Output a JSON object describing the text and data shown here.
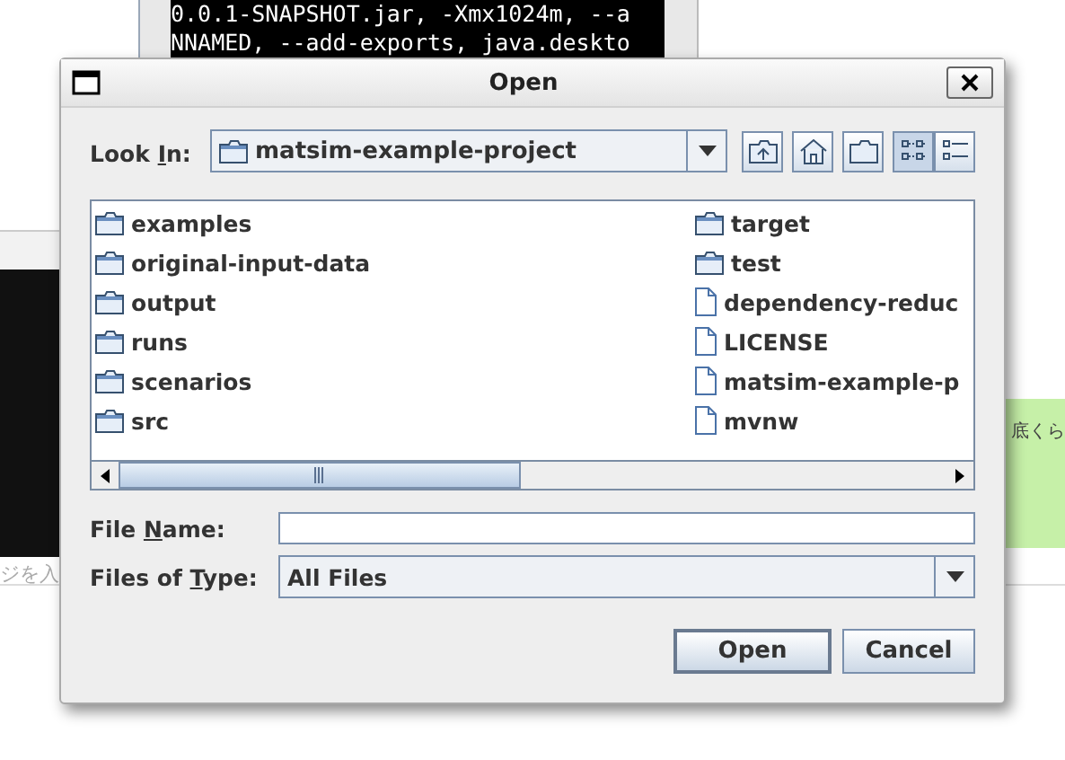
{
  "background": {
    "terminal_lines": [
      "0.0.1-SNAPSHOT.jar, -Xmx1024m, --a",
      "NNAMED, --add-exports, java.deskto"
    ],
    "left_text": "ジを入",
    "right_text": "底くら"
  },
  "window": {
    "title": "Open"
  },
  "look_in": {
    "label_parts": [
      "Look ",
      "I",
      "n:"
    ],
    "value": "matsim-example-project"
  },
  "toolbar": [
    {
      "kind": "up",
      "selected": false
    },
    {
      "kind": "home",
      "selected": false
    },
    {
      "kind": "new-folder",
      "selected": false
    },
    {
      "kind": "list",
      "selected": true
    },
    {
      "kind": "details",
      "selected": false
    }
  ],
  "files": [
    {
      "name": "examples",
      "kind": "folder"
    },
    {
      "name": "original-input-data",
      "kind": "folder"
    },
    {
      "name": "output",
      "kind": "folder"
    },
    {
      "name": "runs",
      "kind": "folder"
    },
    {
      "name": "scenarios",
      "kind": "folder"
    },
    {
      "name": "src",
      "kind": "folder"
    },
    {
      "name": "target",
      "kind": "folder"
    },
    {
      "name": "test",
      "kind": "folder"
    },
    {
      "name": "dependency-reduc",
      "kind": "file"
    },
    {
      "name": "LICENSE",
      "kind": "file"
    },
    {
      "name": "matsim-example-p",
      "kind": "file"
    },
    {
      "name": "mvnw",
      "kind": "file"
    }
  ],
  "file_name": {
    "label_parts": [
      "File ",
      "N",
      "ame:"
    ]
  },
  "file_type": {
    "label_parts": [
      "Files of ",
      "T",
      "ype:"
    ],
    "value": "All Files"
  },
  "buttons": [
    {
      "label": "Open",
      "kind": "default"
    },
    {
      "label": "Cancel",
      "kind": "normal"
    }
  ]
}
